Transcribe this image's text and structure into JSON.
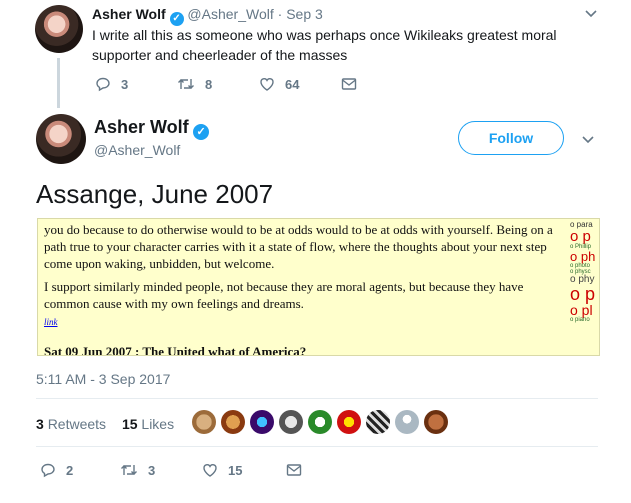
{
  "tweet1": {
    "name": "Asher Wolf",
    "handle": "@Asher_Wolf",
    "date": "· Sep 3",
    "text": "I write all this as someone who was perhaps once Wikileaks greatest moral supporter and cheerleader of the masses",
    "replies": "3",
    "retweets": "8",
    "likes": "64"
  },
  "tweet2": {
    "name": "Asher Wolf",
    "handle": "@Asher_Wolf",
    "follow_label": "Follow",
    "text": "Assange, June 2007",
    "excerpt": {
      "para1": "you do because to do otherwise would to be at odds would to be at odds with yourself. Being on a path true to your character carries with it a state of flow, where the thoughts about your next step come upon waking, unbidden, but welcome.",
      "para2": "I support similarly minded people, not because they are moral agents, but because they have common cause with my own feelings and dreams.",
      "link": "link",
      "date_heading": "Sat 09 Jun 2007 : The United what of America?",
      "side": [
        "o para",
        "o p",
        "o Phillip",
        "o ph",
        "o photo",
        "o physc",
        "o phy",
        "o p",
        "o pl",
        "o piano"
      ]
    },
    "timestamp": "5:11 AM - 3 Sep 2017",
    "retweets_count": "3",
    "retweets_label": "Retweets",
    "likes_count": "15",
    "likes_label": "Likes",
    "replies": "2",
    "retweets": "3",
    "likes": "15"
  },
  "colors": {
    "accent": "#1da1f2",
    "excerpt_bg": "#ffffcc",
    "thread_line": "#ccd6dd",
    "side_red": "#cc0000"
  },
  "icons": [
    "verified-badge-icon",
    "chevron-down-icon",
    "reply-icon",
    "retweet-icon",
    "heart-icon",
    "envelope-icon"
  ]
}
